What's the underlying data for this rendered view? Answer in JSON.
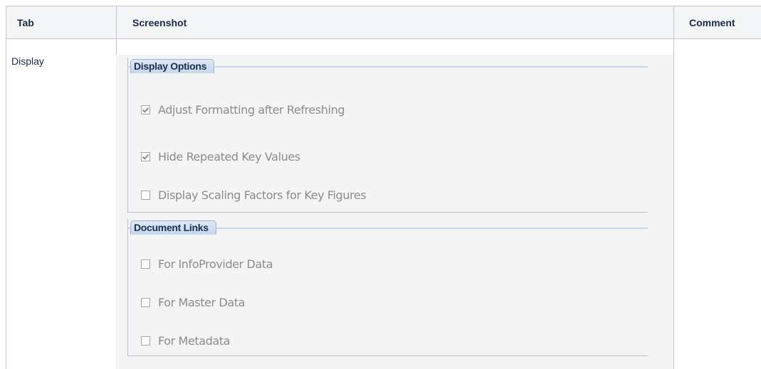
{
  "table": {
    "headers": {
      "tab": "Tab",
      "screenshot": "Screenshot",
      "comment": "Comment"
    },
    "row": {
      "tab": "Display"
    }
  },
  "panel": {
    "groups": [
      {
        "title": "Display Options",
        "options": [
          {
            "label": "Adjust Formatting after Refreshing",
            "checked": true
          },
          {
            "label": "Hide Repeated Key Values",
            "checked": true
          },
          {
            "label": "Display Scaling Factors for Key Figures",
            "checked": false
          }
        ]
      },
      {
        "title": "Document Links",
        "options": [
          {
            "label": "For InfoProvider Data",
            "checked": false
          },
          {
            "label": "For Master Data",
            "checked": false
          },
          {
            "label": "For Metadata",
            "checked": false
          }
        ]
      }
    ]
  }
}
